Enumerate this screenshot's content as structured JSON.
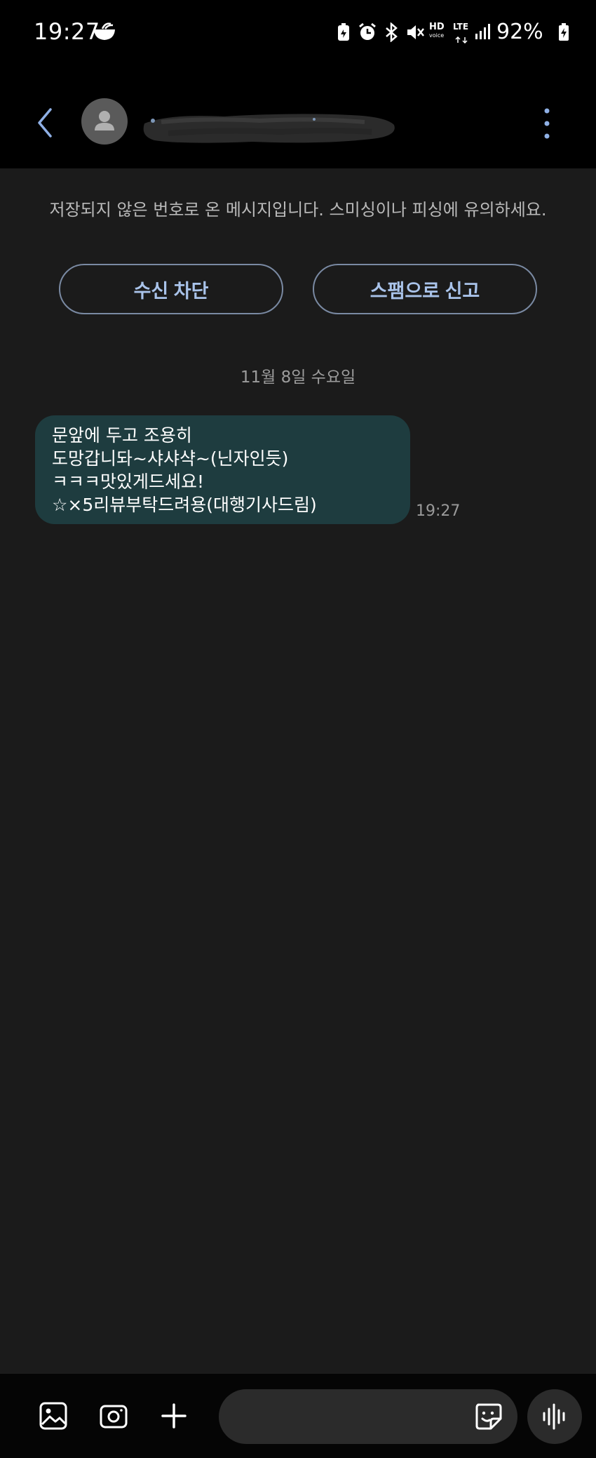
{
  "status_bar": {
    "time": "19:27",
    "hd_label": "HD",
    "hd_sub": "voice",
    "lte_label": "LTE",
    "battery_percent": "92%"
  },
  "header": {
    "contact_name_redacted": true
  },
  "notice": {
    "text": "저장되지 않은 번호로 온 메시지입니다. 스미싱이나 피싱에 유의하세요.",
    "block_button_label": "수신 차단",
    "spam_button_label": "스팸으로 신고"
  },
  "conversation": {
    "date_separator": "11월 8일 수요일",
    "messages": [
      {
        "lines": [
          "문앞에 두고 조용히",
          "도망갑니돠~샤샤샥~(닌자인듯)",
          "ㅋㅋㅋ맛있게드세요!",
          "☆×5리뷰부탁드려용(대행기사드림)"
        ],
        "time": "19:27"
      }
    ]
  },
  "composer": {
    "placeholder": ""
  },
  "colors": {
    "background": "#1b1b1b",
    "bar_background": "#000000",
    "incoming_bubble": "#1e3c3f",
    "accent_button_text": "#a9c3ea",
    "back_arrow": "#8fb0e6"
  }
}
